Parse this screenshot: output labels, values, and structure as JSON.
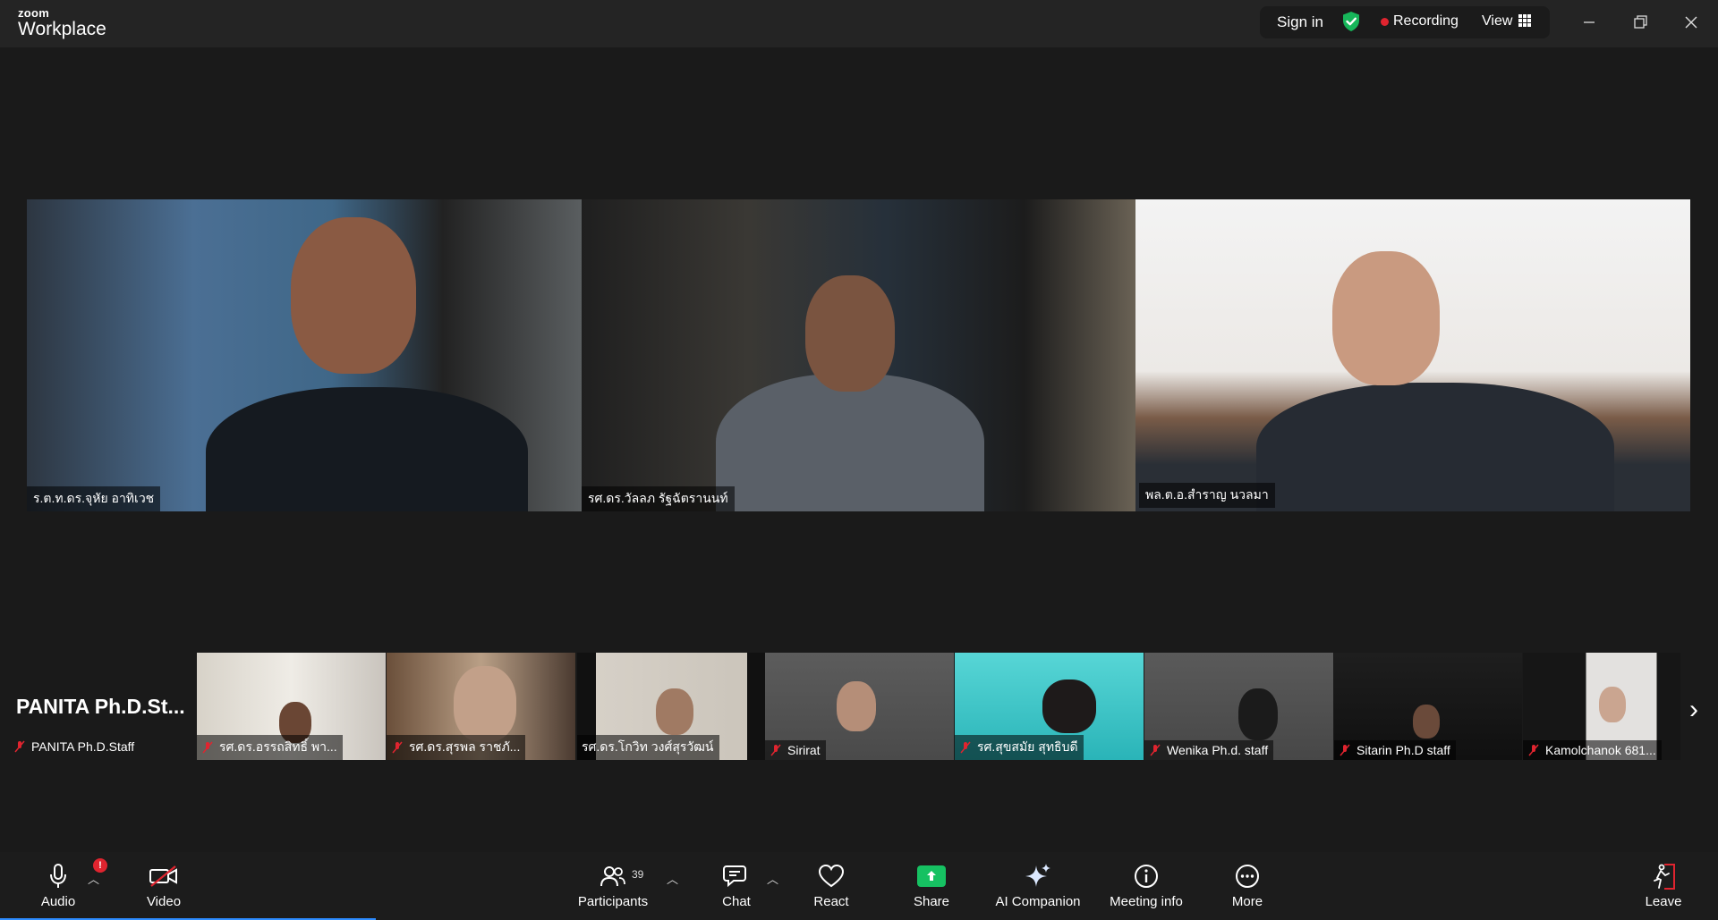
{
  "app": {
    "logo_small": "zoom",
    "logo_big": "Workplace"
  },
  "topbar": {
    "sign_in": "Sign in",
    "recording": "Recording",
    "view": "View"
  },
  "main_tiles": [
    {
      "name": "ร.ต.ท.ดร.จุหัย  อาทิเวช"
    },
    {
      "name": "รศ.ดร.วัลลภ รัฐฉัตรานนท์"
    },
    {
      "name": "พล.ต.อ.สำราญ นวลมา"
    }
  ],
  "filmstrip": {
    "self_name_big": "PANITA  Ph.D.St...",
    "self_name": "PANITA Ph.D.Staff",
    "tiles": [
      {
        "name": "รศ.ดร.อรรถสิทธิ์  พา..."
      },
      {
        "name": "รศ.ดร.สุรพล  ราชภั..."
      },
      {
        "name": "รศ.ดร.โกวิท  วงศ์สุรวัฒน์"
      },
      {
        "name": "Sirirat"
      },
      {
        "name": "รศ.สุขสมัย สุทธิบดี"
      },
      {
        "name": "Wenika Ph.d. staff"
      },
      {
        "name": "Sitarin Ph.D staff"
      },
      {
        "name": "Kamolchanok 681..."
      }
    ]
  },
  "toolbar": {
    "audio": "Audio",
    "audio_badge": "!",
    "video": "Video",
    "participants": "Participants",
    "participants_count": "39",
    "chat": "Chat",
    "react": "React",
    "share": "Share",
    "ai_companion": "AI Companion",
    "meeting_info": "Meeting info",
    "more": "More",
    "leave": "Leave"
  },
  "colors": {
    "active_speaker": "#24d07a",
    "share": "#16c162",
    "recording": "#e0242f",
    "leave": "#e0242f"
  }
}
